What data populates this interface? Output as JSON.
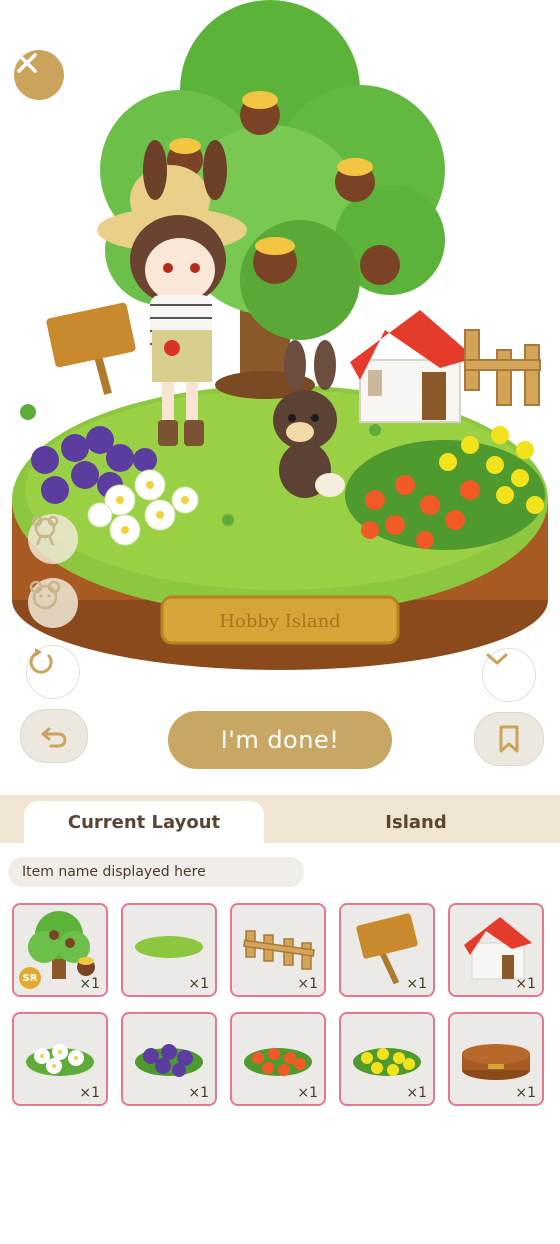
{
  "buttons": {
    "done_label": "I'm done!"
  },
  "plaque_text": "Hobby Island",
  "tabs": [
    {
      "label": "Current Layout",
      "active": true
    },
    {
      "label": "Island",
      "active": false
    }
  ],
  "item_name_display": "Item name displayed here",
  "inventory": {
    "items": [
      {
        "name": "Chestnut Tree",
        "quantity": "×1",
        "rarity": "SR"
      },
      {
        "name": "Grass Patch",
        "quantity": "×1"
      },
      {
        "name": "Wooden Fence",
        "quantity": "×1"
      },
      {
        "name": "Wooden Sign",
        "quantity": "×1"
      },
      {
        "name": "Red Roof House",
        "quantity": "×1"
      },
      {
        "name": "White Flowers",
        "quantity": "×1"
      },
      {
        "name": "Purple Flowers",
        "quantity": "×1"
      },
      {
        "name": "Orange Flowers",
        "quantity": "×1"
      },
      {
        "name": "Yellow Flowers",
        "quantity": "×1"
      },
      {
        "name": "Island Base",
        "quantity": "×1"
      }
    ]
  },
  "colors": {
    "accent_gold": "#c8a663",
    "slot_border": "#e3788f",
    "tab_bar": "#efe5d2"
  }
}
